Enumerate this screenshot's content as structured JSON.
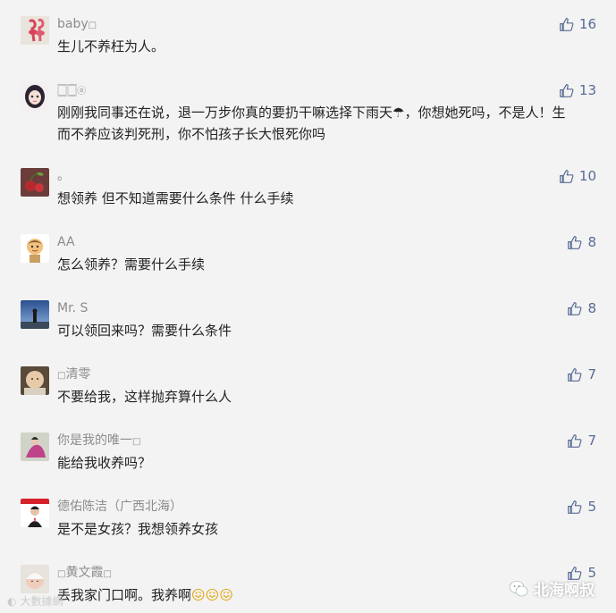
{
  "comments": [
    {
      "name": "baby",
      "name_suffix": "□",
      "text": "生儿不养枉为人。",
      "likes": "16",
      "avatar": "flamingo-avatar"
    },
    {
      "name": "🀆🀆",
      "name_suffix": "ⓞ",
      "text": "刚刚我同事还在说，退一万步你真的要扔干嘛选择下雨天☂，你想她死吗，不是人！生而不养应该判死刑，你不怕孩子长大恨死你吗",
      "likes": "13",
      "avatar": "girl-avatar"
    },
    {
      "name": "。",
      "name_suffix": "",
      "text": "想领养 但不知道需要什么条件 什么手续",
      "likes": "10",
      "avatar": "cherry-avatar"
    },
    {
      "name": "AA",
      "name_suffix": "",
      "text": "怎么领养？需要什么手续",
      "likes": "8",
      "avatar": "cartoon-avatar"
    },
    {
      "name": "Mr. S",
      "name_suffix": "",
      "text": "可以领回来吗？需要什么条件",
      "likes": "8",
      "avatar": "sky-avatar"
    },
    {
      "name": "清零",
      "name_prefix": "□",
      "name_suffix": "",
      "text": "不要给我，这样抛弃算什么人",
      "likes": "7",
      "avatar": "baby-avatar"
    },
    {
      "name": "你是我的唯一",
      "name_suffix": "□",
      "text": "能给我收养吗？",
      "likes": "7",
      "avatar": "pink-avatar"
    },
    {
      "name": "德佑陈洁（广西北海）",
      "name_suffix": "",
      "text": "是不是女孩？我想领养女孩",
      "likes": "5",
      "avatar": "agent-avatar"
    },
    {
      "name": "黄文霞",
      "name_prefix": "□",
      "name_suffix": "□",
      "text": "丢我家门口啊。我养啊",
      "text_emoji": "😖😖😖",
      "likes": "5",
      "avatar": "newborn-avatar"
    }
  ],
  "watermark_left": "大數據網",
  "watermark_right": "北海啊叔",
  "colors": {
    "background": "#f3f3f3",
    "name": "#8c8c8c",
    "text": "#222222",
    "like": "#576b95"
  }
}
